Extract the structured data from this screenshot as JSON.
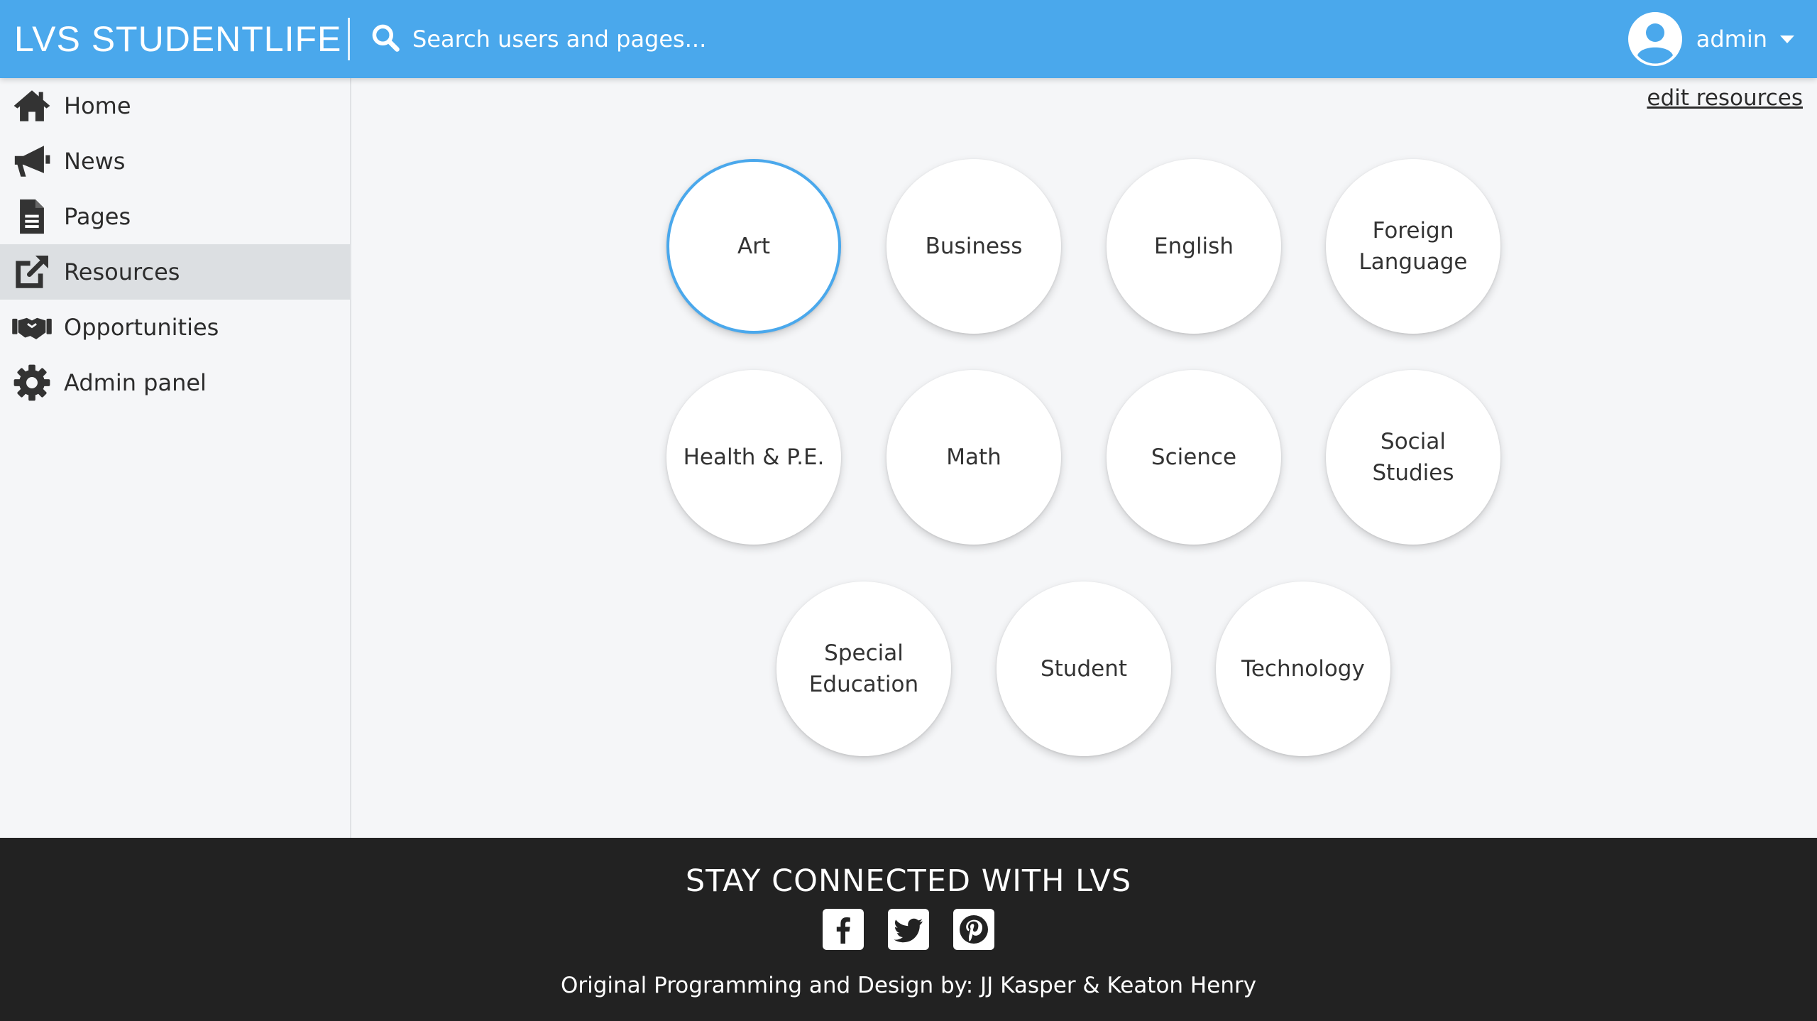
{
  "header": {
    "brand": "LVS STUDENTLIFE",
    "search_placeholder": "Search users and pages...",
    "user_name": "admin"
  },
  "sidebar": {
    "items": [
      {
        "label": "Home",
        "icon": "home-icon"
      },
      {
        "label": "News",
        "icon": "megaphone-icon"
      },
      {
        "label": "Pages",
        "icon": "document-icon"
      },
      {
        "label": "Resources",
        "icon": "external-link-icon",
        "active": true
      },
      {
        "label": "Opportunities",
        "icon": "handshake-icon"
      },
      {
        "label": "Admin panel",
        "icon": "gear-icon"
      }
    ]
  },
  "main": {
    "edit_link": "edit resources",
    "resources": [
      {
        "line1": "Art",
        "line2": ""
      },
      {
        "line1": "Business",
        "line2": ""
      },
      {
        "line1": "English",
        "line2": ""
      },
      {
        "line1": "Foreign",
        "line2": "Language"
      },
      {
        "line1": "Health & P.E.",
        "line2": ""
      },
      {
        "line1": "Math",
        "line2": ""
      },
      {
        "line1": "Science",
        "line2": ""
      },
      {
        "line1": "Social Studies",
        "line2": ""
      },
      {
        "line1": "Special",
        "line2": "Education"
      },
      {
        "line1": "Student",
        "line2": ""
      },
      {
        "line1": "Technology",
        "line2": ""
      }
    ],
    "active_resource": "Art"
  },
  "footer": {
    "title": "STAY CONNECTED WITH LVS",
    "social": [
      "facebook-icon",
      "twitter-icon",
      "pinterest-icon"
    ],
    "credits": "Original Programming and Design by: JJ Kasper & Keaton Henry"
  },
  "colors": {
    "header": "#4aa8ec",
    "accent": "#4aa8ec",
    "footer": "#222222",
    "sidebar_active": "#dcdfe2"
  }
}
